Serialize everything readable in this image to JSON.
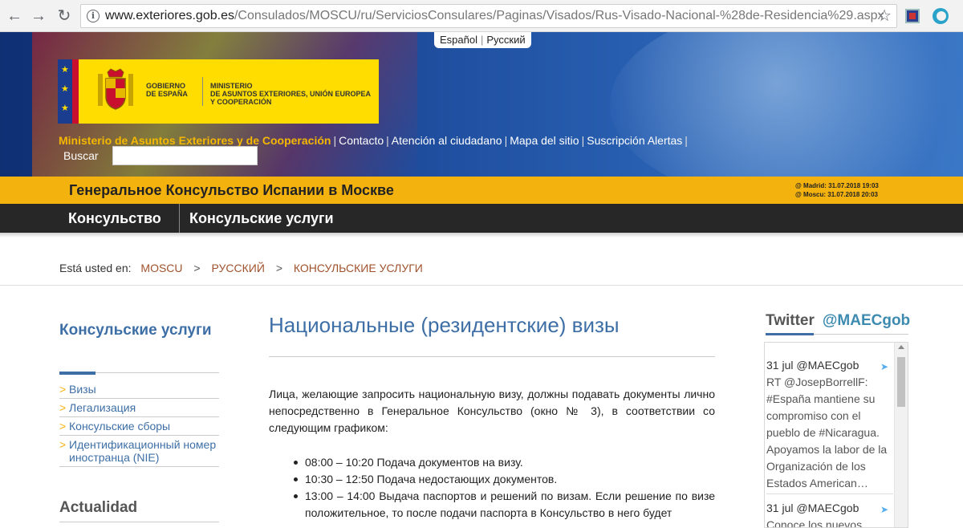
{
  "browser": {
    "url_host": "www.exteriores.gob.es",
    "url_path": "/Consulados/MOSCU/ru/ServiciosConsulares/Paginas/Visados/Rus-Visado-Nacional-%28de-Residencia%29.aspx"
  },
  "banner": {
    "lang_es": "Español",
    "lang_ru": "Русский",
    "gov_line1": "GOBIERNO",
    "gov_line2": "DE ESPAÑA",
    "min_line1": "MINISTERIO",
    "min_line2": "DE ASUNTOS EXTERIORES, UNIÓN EUROPEA",
    "min_line3": "Y COOPERACIÓN",
    "ministry_link": "Ministerio de Asuntos Exteriores y de Cooperación",
    "links": [
      "Contacto",
      "Atención al ciudadano",
      "Mapa del sitio",
      "Suscripción Alertas"
    ],
    "search_label": "Buscar",
    "search_value": ""
  },
  "header": {
    "consulate_title": "Генеральное Консульство Испании в Москве",
    "time_madrid": "@ Madrid: 31.07.2018 19:03",
    "time_moscow": "@ Moscu: 31.07.2018 20:03"
  },
  "menu": {
    "item1": "Консульство",
    "item2": "Консульские услуги"
  },
  "breadcrumb": {
    "prefix": "Está usted en:",
    "items": [
      "MOSCU",
      "РУССКИЙ",
      "КОНСУЛЬСКИЕ УСЛУГИ"
    ]
  },
  "sidebar": {
    "title": "Консульские услуги",
    "items": [
      {
        "label": "Визы"
      },
      {
        "label": "Легализация"
      },
      {
        "label": "Консульские сборы"
      },
      {
        "label": "Идентификационный номер иностранца (NIE)"
      }
    ],
    "section2": "Actualidad"
  },
  "main": {
    "title": "Национальные (резидентские) визы",
    "intro": "Лица, желающие запросить национальную визу, должны подавать документы лично непосредственно в Генеральное Консульство (окно № 3), в соответствии со следующим графиком:",
    "schedule": [
      "08:00 – 10:20  Подача документов на визу.",
      "10:30 – 12:50  Подача недостающих документов.",
      "13:00 – 14:00  Выдача паспортов и решений по визам. Если решение по визе положительное, то после подачи паспорта в Консульство в него будет"
    ]
  },
  "twitter": {
    "title": "Twitter",
    "handle": "@MAECgob",
    "tweets": [
      {
        "date": "31 jul",
        "user": "@MAECgob",
        "text": "RT @JosepBorrellF: #España mantiene su compromiso con el pueblo de #Nicaragua. Apoyamos la labor de la Organización de los Estados American…"
      },
      {
        "date": "31 jul",
        "user": "@MAECgob",
        "text": "Conoce los nuevos"
      }
    ]
  }
}
